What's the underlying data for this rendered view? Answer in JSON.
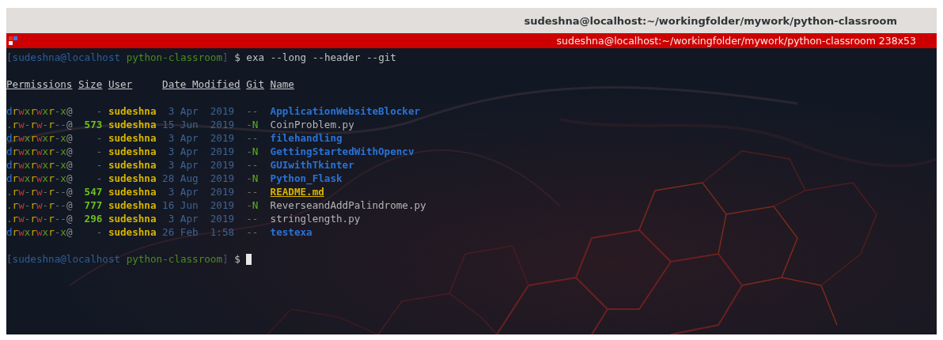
{
  "window": {
    "title": "sudeshna@localhost:~/workingfolder/mywork/python-classroom"
  },
  "tab_bar": {
    "title": "sudeshna@localhost:~/workingfolder/mywork/python-classroom 238x53"
  },
  "terminal": {
    "command_line": {
      "segments": [
        {
          "kind": "punct",
          "text": "["
        },
        {
          "kind": "user",
          "text": "sudeshna@localhost"
        },
        {
          "kind": "dir",
          "text": " python-classroom"
        },
        {
          "kind": "punct",
          "text": "]"
        },
        {
          "kind": "symbol",
          "text": " $ "
        },
        {
          "kind": "command",
          "text": "exa --long --header --git"
        }
      ]
    },
    "columns": [
      "Permissions",
      "Size",
      "User",
      "Date Modified",
      "Git",
      "Name"
    ],
    "rows": [
      {
        "permissions": "drwxrwxr-x@",
        "size": "-",
        "user": "sudeshna",
        "date": "3 Apr  2019",
        "git": "--",
        "name": "ApplicationWebsiteBlocker",
        "kind": "dir"
      },
      {
        "permissions": ".rw-rw-r--@",
        "size": "573",
        "user": "sudeshna",
        "date": "15 Jun  2019",
        "git": "-N",
        "name": "CoinProblem.py",
        "kind": "file"
      },
      {
        "permissions": "drwxrwxr-x@",
        "size": "-",
        "user": "sudeshna",
        "date": "3 Apr  2019",
        "git": "--",
        "name": "filehandling",
        "kind": "dir"
      },
      {
        "permissions": "drwxrwxr-x@",
        "size": "-",
        "user": "sudeshna",
        "date": "3 Apr  2019",
        "git": "-N",
        "name": "GettingStartedWithOpencv",
        "kind": "dir"
      },
      {
        "permissions": "drwxrwxr-x@",
        "size": "-",
        "user": "sudeshna",
        "date": "3 Apr  2019",
        "git": "--",
        "name": "GUIwithTkinter",
        "kind": "dir"
      },
      {
        "permissions": "drwxrwxr-x@",
        "size": "-",
        "user": "sudeshna",
        "date": "28 Aug  2019",
        "git": "-N",
        "name": "Python_Flask",
        "kind": "dir"
      },
      {
        "permissions": ".rw-rw-r--@",
        "size": "547",
        "user": "sudeshna",
        "date": "3 Apr  2019",
        "git": "--",
        "name": "README.md",
        "kind": "readme"
      },
      {
        "permissions": ".rw-rw-r--@",
        "size": "777",
        "user": "sudeshna",
        "date": "16 Jun  2019",
        "git": "-N",
        "name": "ReverseandAddPalindrome.py",
        "kind": "file"
      },
      {
        "permissions": ".rw-rw-r--@",
        "size": "296",
        "user": "sudeshna",
        "date": "3 Apr  2019",
        "git": "--",
        "name": "stringlength.py",
        "kind": "file"
      },
      {
        "permissions": "drwxrwxr-x@",
        "size": "-",
        "user": "sudeshna",
        "date": "26 Feb  1:58",
        "git": "--",
        "name": "testexa",
        "kind": "dir"
      }
    ],
    "prompt_line": {
      "segments": [
        {
          "kind": "punct",
          "text": "["
        },
        {
          "kind": "user",
          "text": "sudeshna@localhost"
        },
        {
          "kind": "dir",
          "text": " python-classroom"
        },
        {
          "kind": "punct",
          "text": "]"
        },
        {
          "kind": "symbol",
          "text": " $ "
        }
      ]
    }
  }
}
